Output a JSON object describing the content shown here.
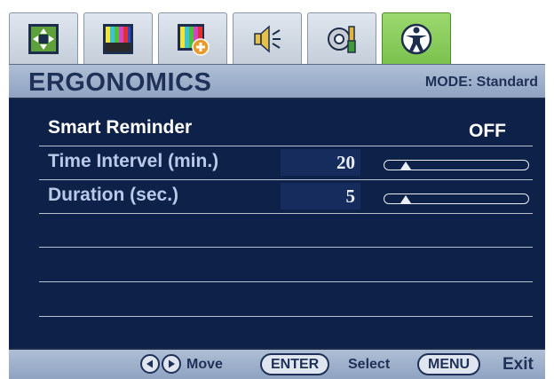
{
  "tabs": [
    {
      "icon": "picture-adjust-icon",
      "active": false
    },
    {
      "icon": "color-bars-icon",
      "active": false
    },
    {
      "icon": "picture-advanced-icon",
      "active": false
    },
    {
      "icon": "audio-icon",
      "active": false
    },
    {
      "icon": "system-settings-icon",
      "active": false
    },
    {
      "icon": "ergonomics-icon",
      "active": true
    }
  ],
  "header": {
    "title": "ERGONOMICS",
    "mode": "MODE: Standard"
  },
  "settings": [
    {
      "label": "Smart Reminder",
      "value": "OFF",
      "label_color": "#ffffff"
    },
    {
      "label": "Time Intervel (min.)",
      "value": "20",
      "label_color": "#b9c9ea",
      "slider_fraction": 0.1
    },
    {
      "label": "Duration (sec.)",
      "value": "5",
      "label_color": "#b9c9ea",
      "slider_fraction": 0.1
    }
  ],
  "footer": {
    "move": "Move",
    "enter": "ENTER",
    "select": "Select",
    "menu": "MENU",
    "exit": "Exit"
  },
  "colors": {
    "panel": "#0d2149",
    "accent_tab": "#8ccf5f",
    "title_text": "#1f3158"
  }
}
